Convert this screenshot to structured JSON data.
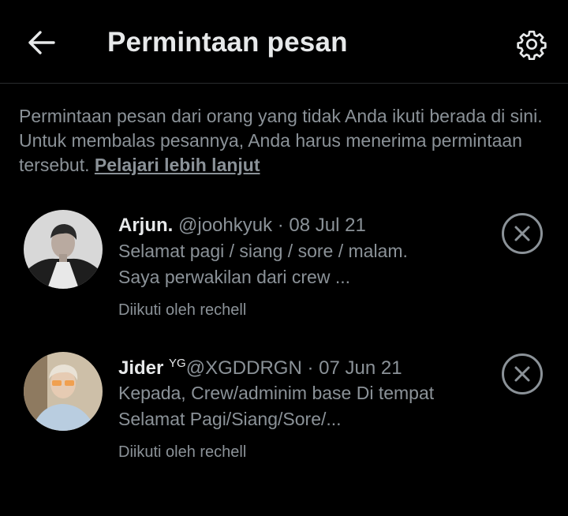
{
  "header": {
    "title": "Permintaan pesan",
    "back_icon": "arrow-left-icon",
    "settings_icon": "gear-icon"
  },
  "info": {
    "text": "Permintaan pesan dari orang yang tidak Anda ikuti berada di sini. Untuk membalas pesannya, Anda harus menerima permintaan tersebut.",
    "link": "Pelajari lebih lanjut"
  },
  "requests": [
    {
      "name": "Arjun.",
      "handle": "@joohkyuk",
      "date": "· 08 Jul 21",
      "preview": "Selamat pagi / siang / sore / malam. Saya perwakilan dari crew ...",
      "followed_by": "Diikuti oleh rechell"
    },
    {
      "name": "Jider",
      "name_badge": "YG",
      "handle": "@XGDDRGN",
      "date": "· 07 Jun 21",
      "preview": "Kepada, Crew/adminim base Di tempat Selamat Pagi/Siang/Sore/...",
      "followed_by": "Diikuti oleh rechell"
    }
  ],
  "colors": {
    "background": "#000000",
    "primary_text": "#e7e9ea",
    "secondary_text": "#8b9298",
    "divider": "#2a2c2e"
  }
}
